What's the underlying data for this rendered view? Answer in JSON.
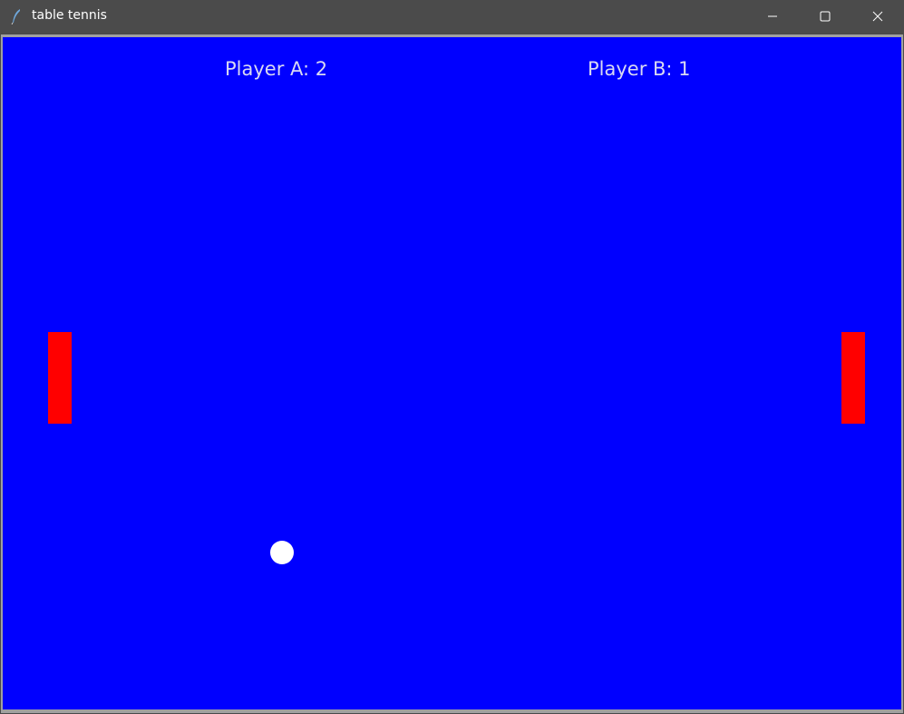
{
  "window": {
    "title": "table tennis",
    "controls": {
      "minimize_icon": "minimize-icon",
      "maximize_icon": "maximize-icon",
      "close_icon": "close-icon"
    }
  },
  "game": {
    "score_a": "Player A: 2",
    "score_b": "Player B: 1",
    "colors": {
      "background": "#0000ff",
      "paddles": "#ff0000",
      "ball": "#ffffff",
      "score_text": "#d9d9f2"
    }
  }
}
